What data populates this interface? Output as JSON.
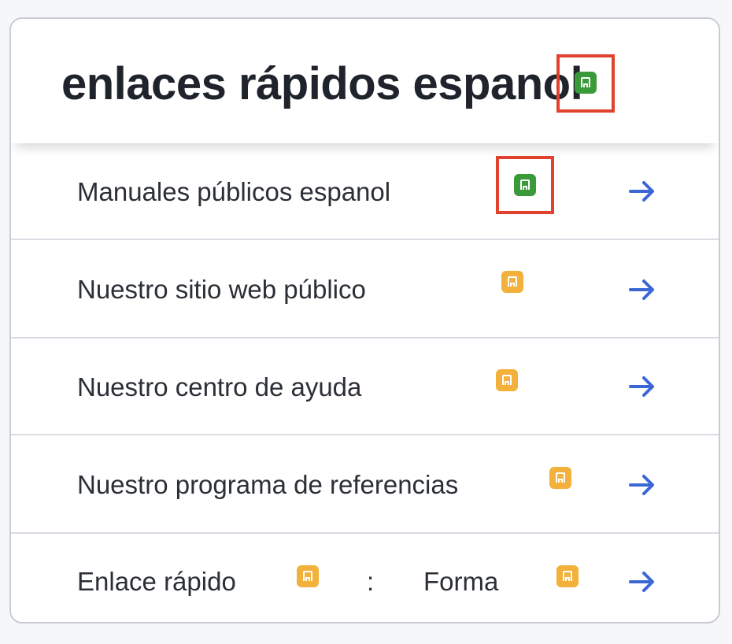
{
  "card": {
    "title": "enlaces rápidos espanol",
    "title_badge": {
      "icon": "edit-square-icon",
      "color": "#3a9a3a",
      "highlighted": true
    },
    "rows": [
      {
        "label": "Manuales públicos espanol",
        "badge": {
          "icon": "edit-square-icon",
          "color": "#3a9a3a",
          "highlighted": true
        },
        "arrow": "right-arrow-icon"
      },
      {
        "label": "Nuestro sitio web público",
        "badge": {
          "icon": "edit-square-icon",
          "color": "#f3b13b",
          "highlighted": false
        },
        "arrow": "right-arrow-icon"
      },
      {
        "label": "Nuestro centro de ayuda",
        "badge": {
          "icon": "edit-square-icon",
          "color": "#f3b13b",
          "highlighted": false
        },
        "arrow": "right-arrow-icon"
      },
      {
        "label": "Nuestro programa de referencias",
        "badge": {
          "icon": "edit-square-icon",
          "color": "#f3b13b",
          "highlighted": false
        },
        "arrow": "right-arrow-icon"
      },
      {
        "label": "Enlace rápido",
        "separator": ":",
        "label2": "Forma",
        "badge": {
          "icon": "edit-square-icon",
          "color": "#f3b13b",
          "highlighted": false
        },
        "badge2": {
          "icon": "edit-square-icon",
          "color": "#f3b13b",
          "highlighted": false
        },
        "arrow": "right-arrow-icon"
      }
    ]
  },
  "colors": {
    "arrow": "#3b66d6",
    "highlight": "#e0422e",
    "text": "#2b2f36"
  }
}
